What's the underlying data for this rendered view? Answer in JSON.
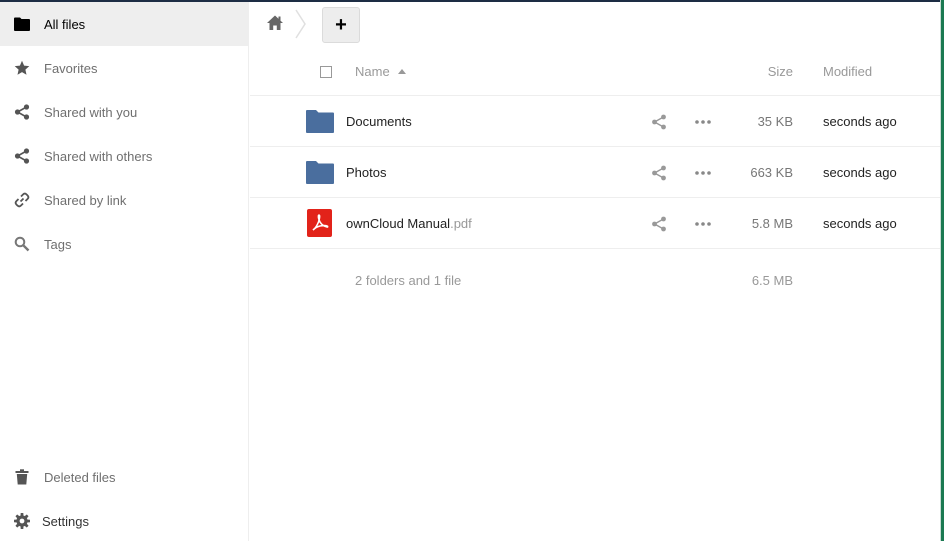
{
  "sidebar": {
    "items": [
      {
        "label": "All files",
        "icon": "folder-icon"
      },
      {
        "label": "Favorites",
        "icon": "star-icon"
      },
      {
        "label": "Shared with you",
        "icon": "share-icon"
      },
      {
        "label": "Shared with others",
        "icon": "share-icon"
      },
      {
        "label": "Shared by link",
        "icon": "link-icon"
      },
      {
        "label": "Tags",
        "icon": "search-icon"
      }
    ],
    "bottom_items": [
      {
        "label": "Deleted files",
        "icon": "trash-icon"
      },
      {
        "label": "Settings",
        "icon": "gear-icon"
      }
    ]
  },
  "controls": {
    "new_label": "+"
  },
  "table": {
    "headers": {
      "name": "Name",
      "size": "Size",
      "modified": "Modified"
    },
    "rows": [
      {
        "name": "Documents",
        "ext": "",
        "type": "folder",
        "size": "35 KB",
        "modified": "seconds ago"
      },
      {
        "name": "Photos",
        "ext": "",
        "type": "folder",
        "size": "663 KB",
        "modified": "seconds ago"
      },
      {
        "name": "ownCloud Manual",
        "ext": ".pdf",
        "type": "pdf",
        "size": "5.8 MB",
        "modified": "seconds ago"
      }
    ],
    "summary": {
      "text": "2 folders and 1 file",
      "size": "6.5 MB"
    }
  },
  "colors": {
    "folder": "#4a6e9e",
    "pdf": "#e2231a",
    "active_bg": "#eeeeee"
  }
}
